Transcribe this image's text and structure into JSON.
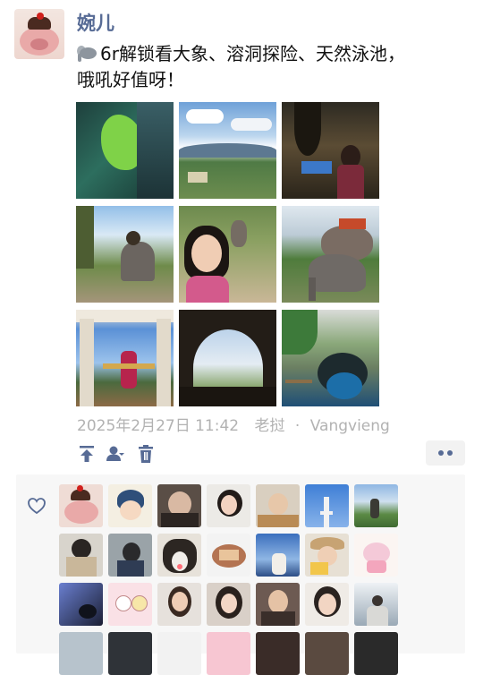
{
  "post": {
    "username": "婉儿",
    "text_line1": "6r解锁看大象、溶洞探险、天然泳池，",
    "text_line2": "哦吼好值呀！",
    "date": "2025年2月27日 11:42",
    "location_name": "老挝",
    "location_sep": "·",
    "location_city": "Vangvieng",
    "photo_count": 9
  },
  "icons": {
    "emoji": "elephant-emoji",
    "actions": [
      "pin-to-top-icon",
      "visibility-icon",
      "delete-icon"
    ],
    "more": "more-dots-icon",
    "like": "heart-outline-icon"
  },
  "likes": {
    "avatar_count": 28
  },
  "colors": {
    "username": "#576b95",
    "meta_text": "#b2b2b2",
    "likes_bg": "#f7f7f7",
    "action_icon": "#576b95"
  }
}
